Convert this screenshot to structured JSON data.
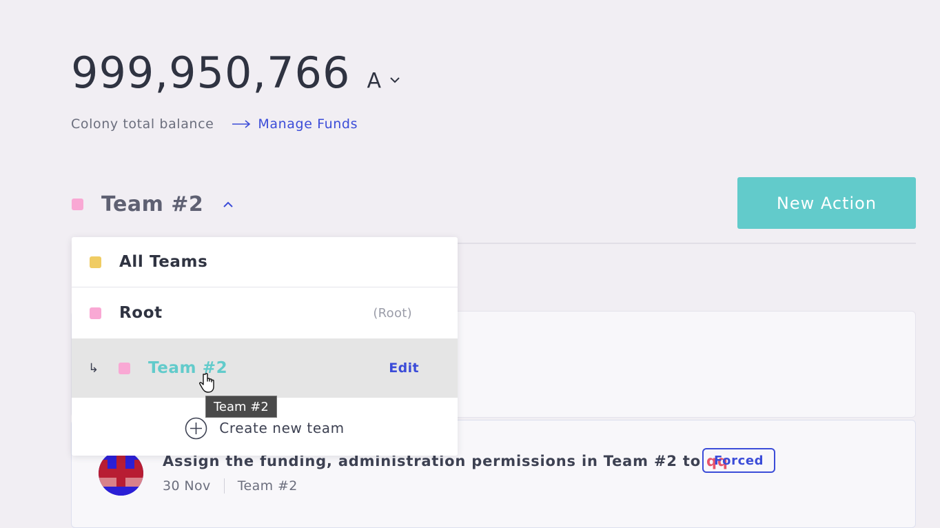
{
  "balance": {
    "amount": "999,950,766",
    "token_symbol": "A",
    "caption": "Colony total balance",
    "manage_link": "Manage Funds"
  },
  "team_selector": {
    "selected_label": "Team #2",
    "color": "#f9a8d4"
  },
  "new_action_button": "New Action",
  "dropdown": {
    "items": [
      {
        "label": "All Teams",
        "color": "#f0cc63"
      },
      {
        "label": "Root",
        "tag": "(Root)",
        "color": "#f9a8d4"
      },
      {
        "label": "Team #2",
        "action": "Edit",
        "color": "#f9a8d4"
      }
    ],
    "create_label": "Create new team",
    "sub_arrow": "↳"
  },
  "tooltip": "Team #2",
  "actions": [
    {
      "title_prefix": "Assign the funding, administration permissions in Team #2 to ",
      "user": "qq",
      "badge": "Forced",
      "date": "30 Nov",
      "team": "Team #2"
    }
  ],
  "colors": {
    "background": "#f1eef3",
    "accent_teal": "#62cbcb",
    "accent_blue": "#3b4cd8",
    "user_red": "#e8536a"
  }
}
